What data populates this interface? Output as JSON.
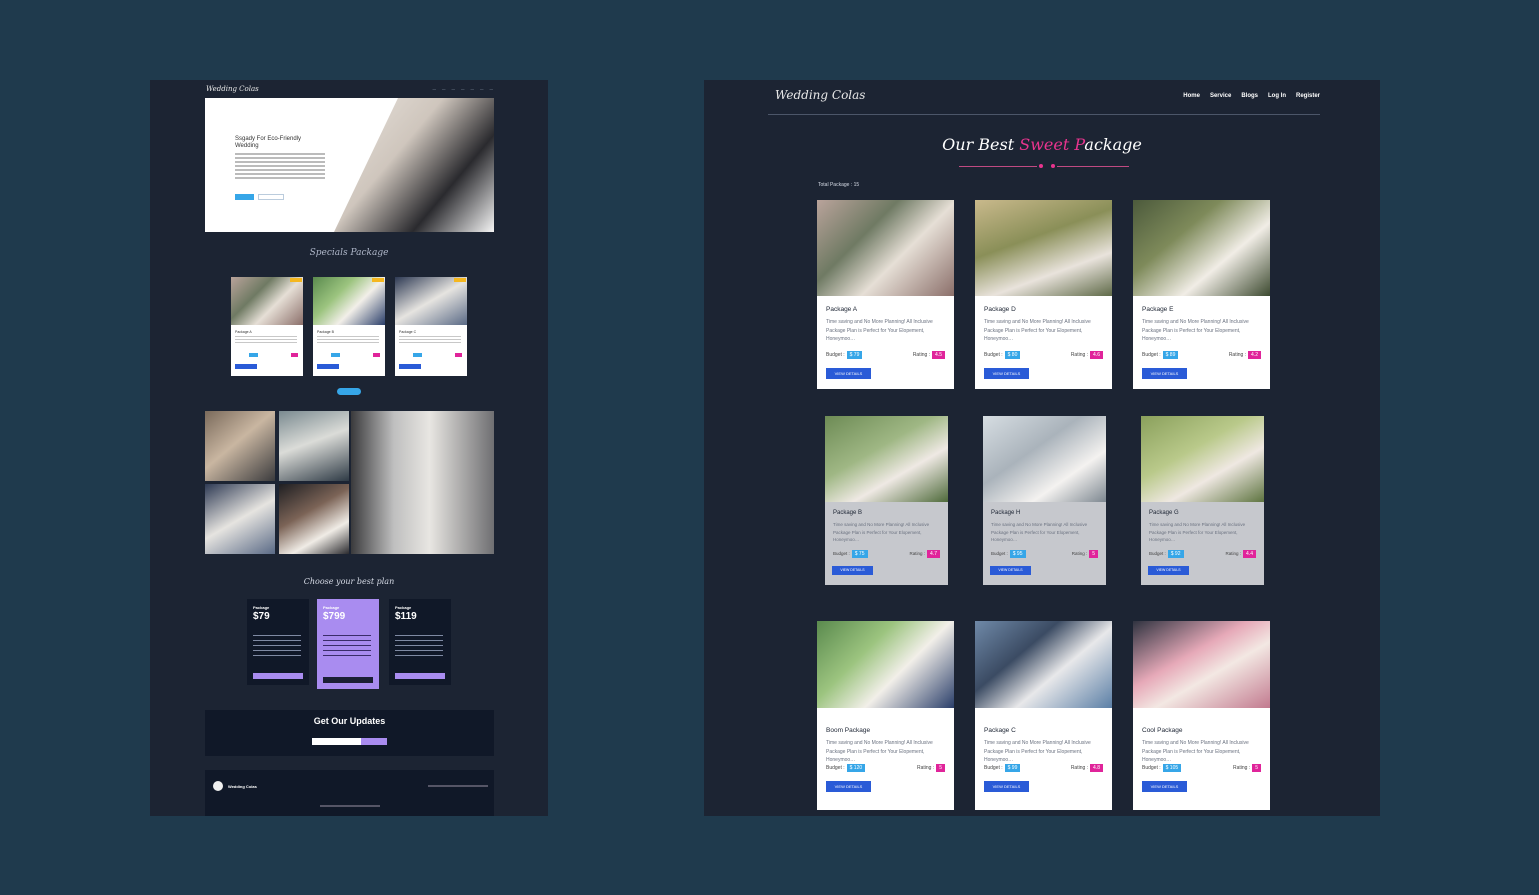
{
  "left_preview": {
    "logo": "Wedding Colas",
    "hero": {
      "kicker": "",
      "headline": "Ssgady For Eco-Friendly Wedding"
    },
    "special_title": "Specials Package",
    "cards": [
      {
        "name": "Package A"
      },
      {
        "name": "Package B"
      },
      {
        "name": "Package C"
      }
    ],
    "plans_kicker": "",
    "plans_title": "Choose your best plan",
    "plans": [
      {
        "name": "Package",
        "price": "$79"
      },
      {
        "name": "Package",
        "price": "$799"
      },
      {
        "name": "Package",
        "price": "$119"
      }
    ],
    "updates_title": "Get Our Updates",
    "footer_brand": "Wedding Colas"
  },
  "header": {
    "logo": "Wedding Colas",
    "nav": [
      "Home",
      "Service",
      "Blogs",
      "Log In",
      "Register"
    ]
  },
  "section": {
    "title_part1": "Our Best ",
    "title_accent": "Sweet P",
    "title_part2": "ackage",
    "total_label": "Total Package : 15"
  },
  "packages": [
    {
      "name": "Package A",
      "desc": "Time saving and No More Planning! All Inclusive Package Plan is Perfect for Your Elopement, Honeymoo…",
      "budget_label": "Budget :",
      "budget": "$ 79",
      "rating_label": "Rating :",
      "rating": "4.5",
      "button": "VIEW DETAILS"
    },
    {
      "name": "Package D",
      "desc": "Time saving and No More Planning! All Inclusive Package Plan is Perfect for Your Elopement, Honeymoo…",
      "budget_label": "Budget :",
      "budget": "$ 80",
      "rating_label": "Rating :",
      "rating": "4.6",
      "button": "VIEW DETAILS"
    },
    {
      "name": "Package E",
      "desc": "Time saving and No More Planning! All Inclusive Package Plan is Perfect for Your Elopement, Honeymoo…",
      "budget_label": "Budget :",
      "budget": "$ 89",
      "rating_label": "Rating :",
      "rating": "4.2",
      "button": "VIEW DETAILS"
    },
    {
      "name": "Package B",
      "desc": "Time saving and No More Planning! All Inclusive Package Plan is Perfect for Your Elopement, Honeymoo…",
      "budget_label": "Budget :",
      "budget": "$ 75",
      "rating_label": "Rating :",
      "rating": "4.7",
      "button": "VIEW DETAILS"
    },
    {
      "name": "Package H",
      "desc": "Time saving and No More Planning! All Inclusive Package Plan is Perfect for Your Elopement, Honeymoo…",
      "budget_label": "Budget :",
      "budget": "$ 95",
      "rating_label": "Rating :",
      "rating": "5",
      "button": "VIEW DETAILS"
    },
    {
      "name": "Package G",
      "desc": "Time saving and No More Planning! All Inclusive Package Plan is Perfect for Your Elopement, Honeymoo…",
      "budget_label": "Budget :",
      "budget": "$ 92",
      "rating_label": "Rating :",
      "rating": "4.4",
      "button": "VIEW DETAILS"
    },
    {
      "name": "Boom Package",
      "desc": "Time saving and No More Planning! All Inclusive Package Plan is Perfect for Your Elopement, Honeymoo…",
      "budget_label": "Budget :",
      "budget": "$ 120",
      "rating_label": "Rating :",
      "rating": "5",
      "button": "VIEW DETAILS"
    },
    {
      "name": "Package C",
      "desc": "Time saving and No More Planning! All Inclusive Package Plan is Perfect for Your Elopement, Honeymoo…",
      "budget_label": "Budget :",
      "budget": "$ 99",
      "rating_label": "Rating :",
      "rating": "4.8",
      "button": "VIEW DETAILS"
    },
    {
      "name": "Cool Package",
      "desc": "Time saving and No More Planning! All Inclusive Package Plan is Perfect for Your Elopement, Honeymoo…",
      "budget_label": "Budget :",
      "budget": "$ 105",
      "rating_label": "Rating :",
      "rating": "5",
      "button": "VIEW DETAILS"
    }
  ],
  "colors": {
    "background": "#1f3a4d",
    "panel": "#1c2433",
    "budget_badge": "#36a6e8",
    "rating_badge": "#e0249a",
    "button": "#2a5bd7",
    "accent_pink": "#e8348e"
  }
}
